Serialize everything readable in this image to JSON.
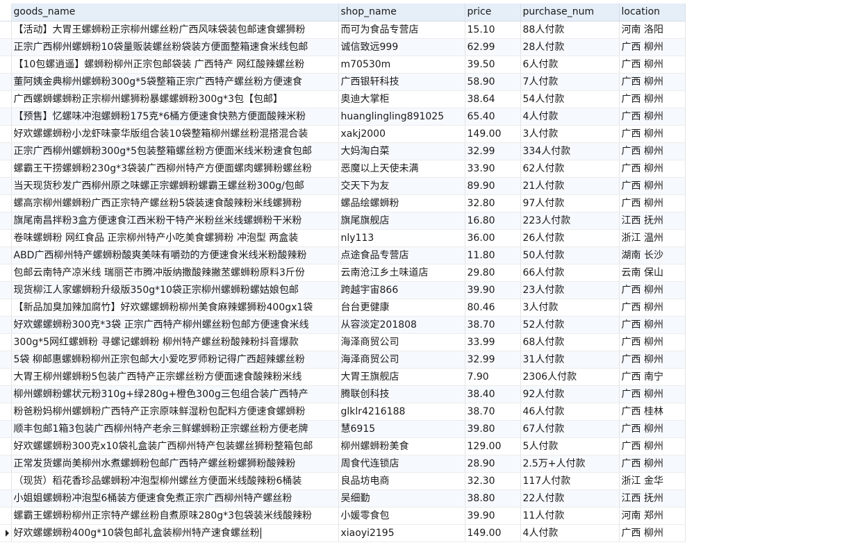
{
  "columns": [
    "goods_name",
    "shop_name",
    "price",
    "purchase_num",
    "location"
  ],
  "rows": [
    [
      "【活动】大胃王螺蛳粉正宗柳州螺丝粉广西风味袋装包邮速食螺狮粉",
      "而可为食品专营店",
      "15.10",
      "88人付款",
      "河南 洛阳"
    ],
    [
      "正宗广西柳州螺蛳粉10袋量贩装螺丝粉袋装方便面整箱速食米线包邮",
      "诚信致远999",
      "62.99",
      "28人付款",
      "广西 柳州"
    ],
    [
      "【10包螺逍遥】螺蛳粉柳州正宗包邮袋装 广西特产 网红酸辣螺丝粉",
      "m70530m",
      "39.50",
      "6人付款",
      "广西 柳州"
    ],
    [
      "董阿姨金典柳州螺蛳粉300g*5袋整箱正宗广西特产螺丝粉方便速食",
      "广西银轩科技",
      "58.90",
      "7人付款",
      "广西 柳州"
    ],
    [
      "广西螺蛳螺蛳粉正宗柳州螺狮粉暴螺螺蛳粉300g*3包【包邮】",
      "奥迪大掌柜",
      "38.64",
      "54人付款",
      "广西 柳州"
    ],
    [
      "【预售】忆螺味冲泡螺蛳粉175克*6桶方便速食快熟方便面酸辣米粉",
      "huanglingling891025",
      "65.40",
      "4人付款",
      "广西 柳州"
    ],
    [
      "好欢螺螺蛳粉小龙虾味豪华版组合装10袋整箱柳州螺丝粉混搭混合装",
      "xakj2000",
      "149.00",
      "3人付款",
      "广西 柳州"
    ],
    [
      "正宗广西柳州螺蛳粉300g*5包装整箱螺丝粉方便面米线米粉速食包邮",
      "大妈淘白菜",
      "32.99",
      "334人付款",
      "广西 柳州"
    ],
    [
      "螺霸王干捞螺蛳粉230g*3袋装广西柳州特产方便面螺肉螺狮粉螺丝粉",
      "恶魔以上天使未满",
      "33.90",
      "62人付款",
      "广西 柳州"
    ],
    [
      "当天现货秒发广西柳州原之味螺正宗螺蛳粉螺霸王螺丝粉300g/包邮",
      "交天下为友",
      "89.90",
      "21人付款",
      "广西 柳州"
    ],
    [
      "螺高宗柳州螺蛳粉广西正宗特产螺丝粉5袋装速食酸辣粉米线螺狮粉",
      "螺品绘螺蛳粉",
      "32.80",
      "97人付款",
      "广西 柳州"
    ],
    [
      "旗尾南昌拌粉3盒方便速食江西米粉干特产米粉丝米线螺蛳粉干米粉",
      "旗尾旗舰店",
      "16.80",
      "223人付款",
      "江西 抚州"
    ],
    [
      "卷味螺蛳粉 网红食品 正宗柳州特产小吃美食螺狮粉 冲泡型 两盒装",
      "nly113",
      "36.00",
      "26人付款",
      "浙江 温州"
    ],
    [
      "ABD广西柳州特产螺蛳粉酸爽美味有嚼劲的方便速食米线米粉酸辣粉",
      "点途食品专营店",
      "11.80",
      "50人付款",
      "湖南 长沙"
    ],
    [
      "包邮云南特产凉米线 瑞丽芒市腾冲版纳撒酸辣撇苤螺蛳粉原料3斤份",
      "云南沧江乡土味道店",
      "29.80",
      "66人付款",
      "云南 保山"
    ],
    [
      "现货柳江人家螺蛳粉升级版350g*10袋正宗柳州螺蛳粉螺姑娘包邮",
      "跨越宇宙866",
      "39.90",
      "23人付款",
      "广西 柳州"
    ],
    [
      "【新品加臭加辣加腐竹】好欢螺螺蛳粉柳州美食麻辣螺狮粉400gx1袋",
      "台台更健康",
      "80.46",
      "3人付款",
      "广西 柳州"
    ],
    [
      "好欢螺螺蛳粉300克*3袋 正宗广西特产柳州螺丝粉包邮方便速食米线",
      "从容淡定201808",
      "38.70",
      "52人付款",
      "广西 柳州"
    ],
    [
      "300g*5网红螺蛳粉 寻螺记螺蛳粉 柳州特产螺丝粉酸辣粉抖音爆款",
      "海泽商贸公司",
      "33.99",
      "68人付款",
      "广西 柳州"
    ],
    [
      "5袋 柳邮惠螺蛳粉柳州正宗包邮大小爱吃罗师粉记得广西超辣螺丝粉",
      "海泽商贸公司",
      "32.99",
      "31人付款",
      "广西 柳州"
    ],
    [
      "大胃王柳州螺蛳粉5包装广西特产正宗螺丝粉方便面速食酸辣粉米线",
      "大胃王旗舰店",
      "7.90",
      "2306人付款",
      "广西 南宁"
    ],
    [
      "柳州螺蛳粉螺状元粉310g+绿280g+橙色300g三包组合装广西特产",
      "腾联创科技",
      "38.40",
      "92人付款",
      "广西 柳州"
    ],
    [
      "粉爸粉妈柳州螺蛳粉广西特产正宗原味鲜湿粉包配料方便速食螺蛳粉",
      "glklr4216188",
      "38.70",
      "46人付款",
      "广西 桂林"
    ],
    [
      "顺丰包邮1箱3包装广西柳州特产老余三鲜螺蛳粉正宗螺丝粉方便老牌",
      "慧6915",
      "39.80",
      "67人付款",
      "广西 柳州"
    ],
    [
      "好欢螺螺蛳粉300克x10袋礼盒装广西柳州特产包装螺丝狮粉整箱包邮",
      "柳州螺蛳粉美食",
      "129.00",
      "5人付款",
      "广西 柳州"
    ],
    [
      "正常发货螺尚美柳州水煮螺蛳粉包邮广西特产螺丝粉螺狮粉酸辣粉",
      "周食代连锁店",
      "28.90",
      "2.5万+人付款",
      "广西 柳州"
    ],
    [
      "（现货）稻花香珍品螺蛳粉冲泡型柳州螺丝方便面米线酸辣粉6桶装",
      "良品坊电商",
      "32.30",
      "117人付款",
      "浙江 金华"
    ],
    [
      "小姐姐螺蛳粉冲泡型6桶装方便速食免煮正宗广西柳州特产螺丝粉",
      "吴细勤",
      "38.80",
      "22人付款",
      "江西 抚州"
    ],
    [
      "螺霸王螺蛳粉柳州正宗特产螺丝粉自煮原味280g*3包袋装米线酸辣粉",
      "小媛零食包",
      "39.90",
      "11人付款",
      "河南 郑州"
    ],
    [
      "好欢螺螺蛳粉400g*10袋包邮礼盒装柳州特产速食螺丝粉",
      "xiaoyi2195",
      "149.00",
      "4人付款",
      "广西 柳州"
    ]
  ],
  "active_row": 29
}
